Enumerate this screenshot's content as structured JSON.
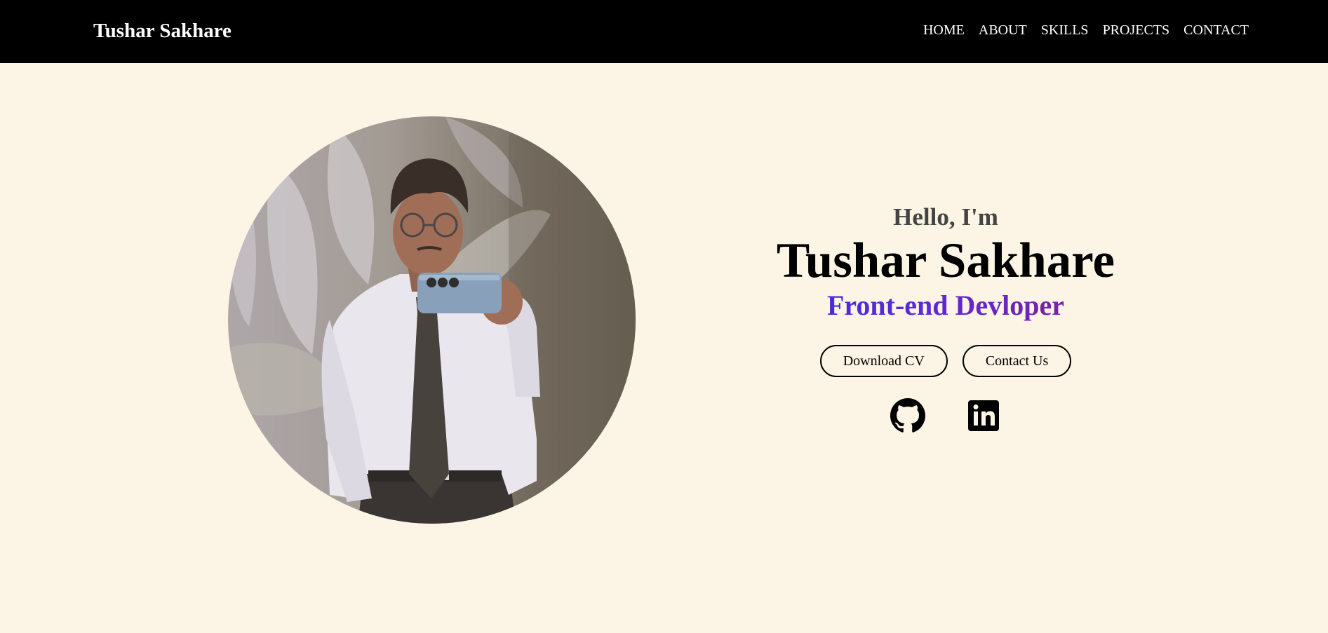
{
  "nav": {
    "brand": "Tushar Sakhare",
    "links": [
      "HOME",
      "ABOUT",
      "SKILLS",
      "PROJECTS",
      "CONTACT"
    ]
  },
  "hero": {
    "greeting": "Hello, I'm",
    "name": "Tushar Sakhare",
    "role": "Front-end Devloper",
    "buttons": {
      "download": "Download CV",
      "contact": "Contact Us"
    }
  },
  "social": {
    "icons": [
      "github-icon",
      "linkedin-icon"
    ]
  },
  "colors": {
    "navbar_bg": "#000000",
    "page_bg": "#fcf4e5",
    "role_gradient_start": "#3a2fe0",
    "role_gradient_end": "#8a1b8e"
  }
}
